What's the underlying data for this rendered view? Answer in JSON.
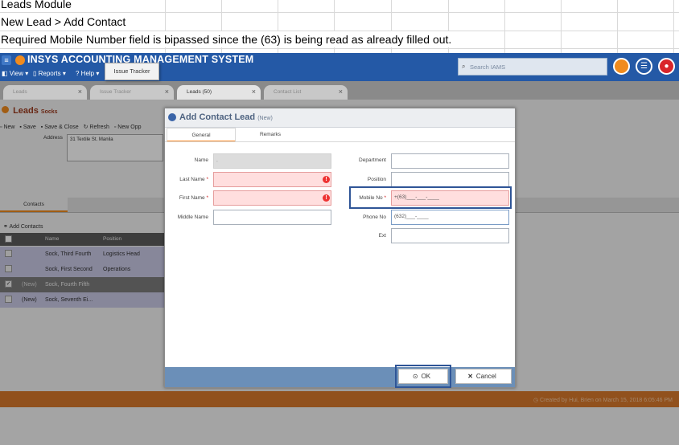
{
  "spreadsheet": {
    "row1": "Leads Module",
    "row2": "New Lead > Add Contact",
    "row3": "Required Mobile Number field is bipassed since the (63) is being read as already filled out."
  },
  "app": {
    "title": "INSYS ACCOUNTING MANAGEMENT SYSTEM",
    "menu": {
      "view": "View",
      "reports": "Reports",
      "help": "Help"
    },
    "search_placeholder": "Search IAMS",
    "tooltip": "Issue Tracker",
    "tabs": [
      {
        "label": "Leads"
      },
      {
        "label": "Issue Tracker"
      },
      {
        "label": "Leads (50)"
      },
      {
        "label": "Contact List"
      }
    ]
  },
  "page": {
    "title": "Leads",
    "subtitle": "Socks",
    "toolbar": {
      "new": "New",
      "save": "Save",
      "save_close": "Save & Close",
      "refresh": "Refresh",
      "new_opp": "New Opp"
    },
    "address_label": "Address",
    "address_value": "31 Textile St. Manila",
    "contacts_tab": "Contacts",
    "add_contacts": "Add Contacts",
    "table": {
      "headers": [
        "",
        "Name",
        "Position"
      ],
      "rows": [
        {
          "tag": "",
          "name": "Sock, Third Fourth",
          "position": "Logistics Head",
          "checked": false
        },
        {
          "tag": "",
          "name": "Sock, First Second",
          "position": "Operations",
          "checked": false
        },
        {
          "tag": "(New)",
          "name": "Sock, Fourth Fifth",
          "position": "",
          "checked": true
        },
        {
          "tag": "(New)",
          "name": "Sock, Seventh Ei...",
          "position": "",
          "checked": false
        }
      ]
    },
    "credit": "Created by Hui, Brien on March 15, 2018 6:05:46 PM"
  },
  "modal": {
    "title": "Add Contact Lead",
    "title_tag": "(New)",
    "tabs": {
      "general": "General",
      "remarks": "Remarks"
    },
    "fields": {
      "name": {
        "label": "Name",
        "value": ","
      },
      "last_name": {
        "label": "Last Name",
        "value": ""
      },
      "first_name": {
        "label": "First Name",
        "value": ""
      },
      "middle_name": {
        "label": "Middle Name",
        "value": ""
      },
      "department": {
        "label": "Department",
        "value": ""
      },
      "position": {
        "label": "Position",
        "value": ""
      },
      "mobile_no": {
        "label": "Mobile No",
        "value": "+(63)___-___-____"
      },
      "phone_no": {
        "label": "Phone No",
        "value": "(632)___-____"
      },
      "ext": {
        "label": "Ext",
        "value": ""
      }
    },
    "required_mark": "*",
    "ok_label": "OK",
    "cancel_label": "Cancel"
  },
  "colors": {
    "topbar": "#2459a6",
    "accent_orange": "#f08b1e",
    "error_fill": "#ffdede",
    "highlight_border": "#2f5597",
    "modal_footer": "#6b8fb8"
  }
}
